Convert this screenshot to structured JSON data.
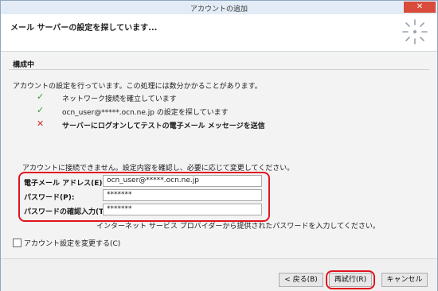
{
  "window": {
    "title": "アカウントの追加",
    "close_glyph": "✕"
  },
  "header": {
    "heading": "メール サーバーの設定を探しています..."
  },
  "content": {
    "section_title": "構成中",
    "intro": "アカウントの設定を行っています。この処理には数分かかることがあります。",
    "steps": [
      {
        "status": "ok",
        "status_glyph": "✓",
        "text": "ネットワーク接続を確立しています"
      },
      {
        "status": "ok",
        "status_glyph": "✓",
        "text": "ocn_user@*****.ocn.ne.jp の設定を探しています"
      },
      {
        "status": "error",
        "status_glyph": "✕",
        "text": "サーバーにログオンしてテストの電子メール メッセージを送信"
      }
    ],
    "notice": "アカウントに接続できません。設定内容を確認し、必要に応じて変更してください。",
    "fields": {
      "email": {
        "label": "電子メール アドレス(E):",
        "value": "ocn_user@*****.ocn.ne.jp"
      },
      "password": {
        "label": "パスワード(P):",
        "value": "*******"
      },
      "password_confirm": {
        "label": "パスワードの確認入力(T):",
        "value": "*******"
      }
    },
    "help": "インターネット サービス プロバイダーから提供されたパスワードを入力してください。",
    "change_settings": {
      "label": "アカウント設定を変更する(C)",
      "checked": false
    }
  },
  "footer": {
    "back_label": "< 戻る(B)",
    "retry_label": "再試行(R)",
    "cancel_label": "キャンセル"
  },
  "colors": {
    "highlight": "#e0141d",
    "ok": "#2f9a2f",
    "error": "#d22c2c"
  }
}
